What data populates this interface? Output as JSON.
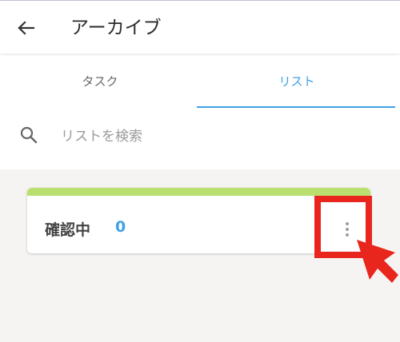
{
  "header": {
    "back_icon": "arrow-left-icon",
    "title": "アーカイブ"
  },
  "tabs": [
    {
      "label": "タスク",
      "active": false
    },
    {
      "label": "リスト",
      "active": true
    }
  ],
  "search": {
    "icon": "search-icon",
    "placeholder": "リストを検索",
    "value": ""
  },
  "lists": [
    {
      "name": "確認中",
      "count": "0",
      "accent_color": "#b9e06e",
      "menu_icon": "more-vert-icon"
    }
  ],
  "annotation": {
    "highlight_color": "#e8261e",
    "pointer_icon": "red-pointer-arrow-icon"
  },
  "colors": {
    "accent": "#3fa1e6",
    "background": "#f6f4f2"
  }
}
